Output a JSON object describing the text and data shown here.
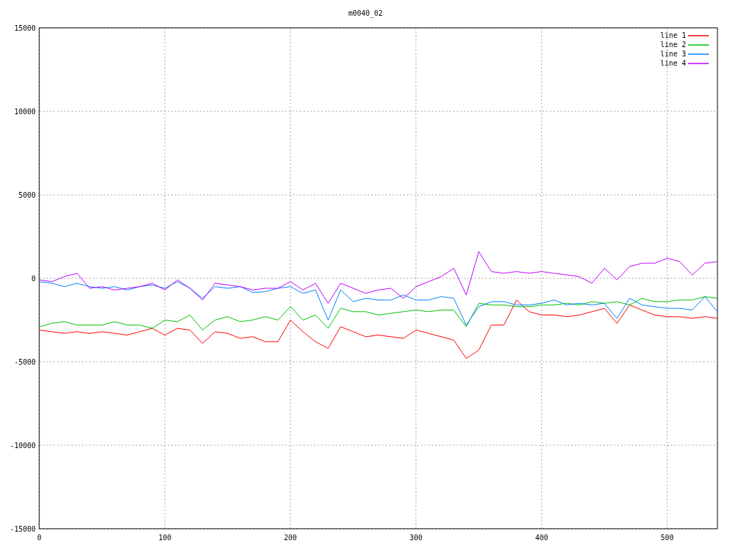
{
  "plot": {
    "chart_data": {
      "type": "line",
      "title": "m0040_02",
      "x": [
        0,
        10,
        20,
        30,
        40,
        50,
        60,
        70,
        80,
        90,
        100,
        110,
        120,
        130,
        140,
        150,
        160,
        170,
        180,
        190,
        200,
        210,
        220,
        230,
        240,
        250,
        260,
        270,
        280,
        290,
        300,
        310,
        320,
        330,
        340,
        350,
        360,
        370,
        380,
        390,
        400,
        410,
        420,
        430,
        440,
        450,
        460,
        470,
        480,
        490,
        500,
        510,
        520,
        530,
        540
      ],
      "series": [
        {
          "name": "line 1",
          "color": "#ff0000",
          "values": [
            -3100,
            -3200,
            -3300,
            -3200,
            -3300,
            -3200,
            -3300,
            -3400,
            -3200,
            -3000,
            -3400,
            -3000,
            -3100,
            -3900,
            -3200,
            -3300,
            -3600,
            -3500,
            -3800,
            -3800,
            -2500,
            -3200,
            -3800,
            -4200,
            -2900,
            -3200,
            -3500,
            -3400,
            -3500,
            -3600,
            -3100,
            -3300,
            -3500,
            -3700,
            -4800,
            -4300,
            -2800,
            -2800,
            -1300,
            -2000,
            -2200,
            -2200,
            -2300,
            -2200,
            -2000,
            -1800,
            -2700,
            -1600,
            -1900,
            -2200,
            -2300,
            -2300,
            -2400,
            -2300,
            -2400
          ]
        },
        {
          "name": "line 2",
          "color": "#00c000",
          "values": [
            -2900,
            -2700,
            -2600,
            -2800,
            -2800,
            -2800,
            -2600,
            -2800,
            -2800,
            -3000,
            -2500,
            -2600,
            -2200,
            -3100,
            -2500,
            -2300,
            -2600,
            -2500,
            -2300,
            -2500,
            -1700,
            -2500,
            -2200,
            -3000,
            -1800,
            -2000,
            -2000,
            -2200,
            -2100,
            -2000,
            -1900,
            -2000,
            -1900,
            -1900,
            -2900,
            -1500,
            -1600,
            -1600,
            -1700,
            -1700,
            -1600,
            -1600,
            -1500,
            -1600,
            -1400,
            -1500,
            -1400,
            -1600,
            -1200,
            -1400,
            -1400,
            -1300,
            -1300,
            -1100,
            -1200
          ]
        },
        {
          "name": "line 3",
          "color": "#0080ff",
          "values": [
            -200,
            -300,
            -500,
            -300,
            -500,
            -600,
            -500,
            -700,
            -500,
            -400,
            -600,
            -200,
            -600,
            -1200,
            -500,
            -600,
            -500,
            -850,
            -800,
            -600,
            -500,
            -900,
            -700,
            -2500,
            -700,
            -1400,
            -1200,
            -1300,
            -1300,
            -1000,
            -1300,
            -1300,
            -1100,
            -1200,
            -2800,
            -1700,
            -1400,
            -1400,
            -1600,
            -1600,
            -1500,
            -1300,
            -1600,
            -1500,
            -1600,
            -1500,
            -2400,
            -1200,
            -1600,
            -1700,
            -1800,
            -1800,
            -1900,
            -1100,
            -2000
          ]
        },
        {
          "name": "line 4",
          "color": "#c000ff",
          "values": [
            -100,
            -200,
            100,
            300,
            -600,
            -500,
            -700,
            -600,
            -500,
            -300,
            -700,
            -100,
            -600,
            -1300,
            -300,
            -400,
            -500,
            -700,
            -600,
            -600,
            -200,
            -700,
            -300,
            -1500,
            -300,
            -600,
            -900,
            -700,
            -600,
            -1200,
            -500,
            -200,
            100,
            600,
            -1000,
            1600,
            400,
            300,
            400,
            300,
            400,
            300,
            200,
            100,
            -300,
            600,
            -100,
            700,
            900,
            900,
            1200,
            1000,
            200,
            900,
            1000
          ]
        }
      ],
      "grid": true,
      "legend": true,
      "xlim": [
        0,
        540
      ],
      "ylim": [
        -15000,
        15000
      ],
      "xticks": [
        0,
        100,
        200,
        300,
        400,
        500
      ],
      "yticks": [
        -15000,
        -10000,
        -5000,
        0,
        5000,
        10000,
        15000
      ]
    }
  }
}
